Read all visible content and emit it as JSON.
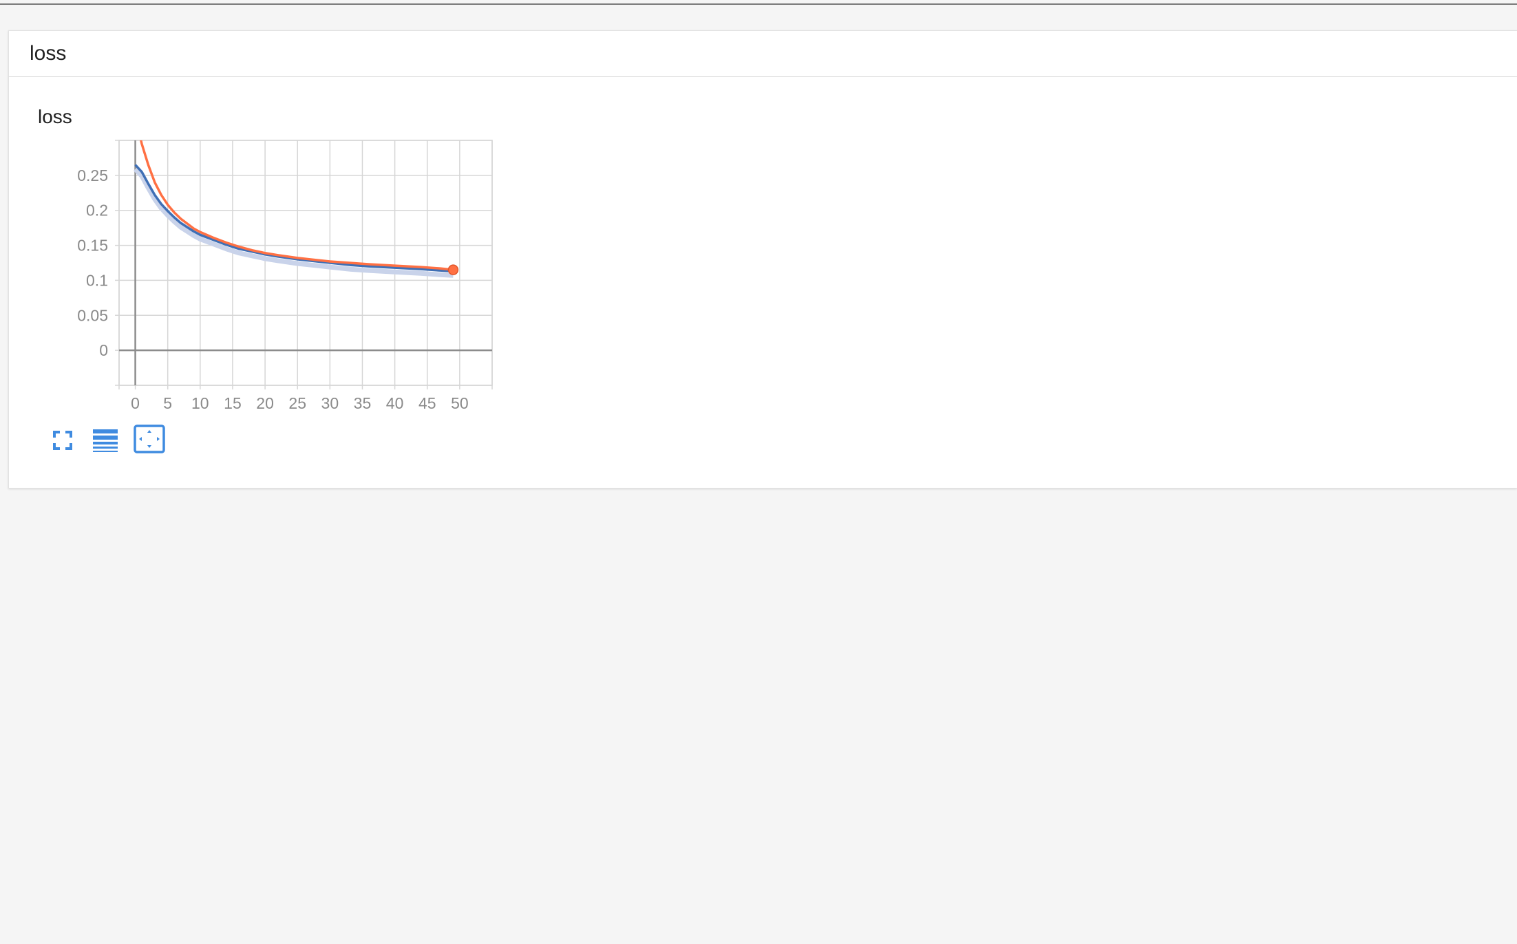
{
  "card": {
    "header_title": "loss"
  },
  "chart_data": {
    "type": "line",
    "title": "loss",
    "xlabel": "",
    "ylabel": "",
    "xlim": [
      -2.5,
      55
    ],
    "ylim": [
      -0.05,
      0.3
    ],
    "x_ticks": [
      0,
      5,
      10,
      15,
      20,
      25,
      30,
      35,
      40,
      45,
      50
    ],
    "y_ticks": [
      0,
      0.05,
      0.1,
      0.15,
      0.2,
      0.25
    ],
    "y_tick_labels": [
      "0",
      "0.05",
      "0.1",
      "0.15",
      "0.2",
      "0.25"
    ],
    "grid": true,
    "series": [
      {
        "color": "#ff7043",
        "x": [
          0,
          1,
          2,
          3,
          4,
          5,
          6,
          7,
          8,
          9,
          10,
          12,
          14,
          16,
          18,
          20,
          22,
          25,
          28,
          30,
          33,
          36,
          40,
          44,
          47,
          49
        ],
        "values": [
          0.335,
          0.295,
          0.265,
          0.24,
          0.222,
          0.208,
          0.197,
          0.188,
          0.181,
          0.174,
          0.169,
          0.161,
          0.154,
          0.148,
          0.143,
          0.139,
          0.136,
          0.132,
          0.129,
          0.127,
          0.125,
          0.123,
          0.121,
          0.119,
          0.117,
          0.115
        ]
      },
      {
        "color": "#3f6fb5",
        "x": [
          0,
          1,
          2,
          3,
          4,
          5,
          6,
          7,
          8,
          9,
          10,
          12,
          14,
          16,
          18,
          20,
          22,
          25,
          28,
          30,
          33,
          36,
          40,
          44,
          47,
          49
        ],
        "values": [
          0.265,
          0.255,
          0.238,
          0.222,
          0.209,
          0.199,
          0.19,
          0.182,
          0.176,
          0.17,
          0.165,
          0.158,
          0.151,
          0.145,
          0.141,
          0.137,
          0.134,
          0.13,
          0.127,
          0.125,
          0.122,
          0.12,
          0.118,
          0.116,
          0.114,
          0.113
        ]
      }
    ],
    "last_point": {
      "x": 49,
      "y": 0.115,
      "color": "#ff7043"
    }
  },
  "toolbar": {
    "icons": [
      "expand-icon",
      "list-lines-icon",
      "fit-domain-icon"
    ],
    "accent": "#3f8be0"
  }
}
